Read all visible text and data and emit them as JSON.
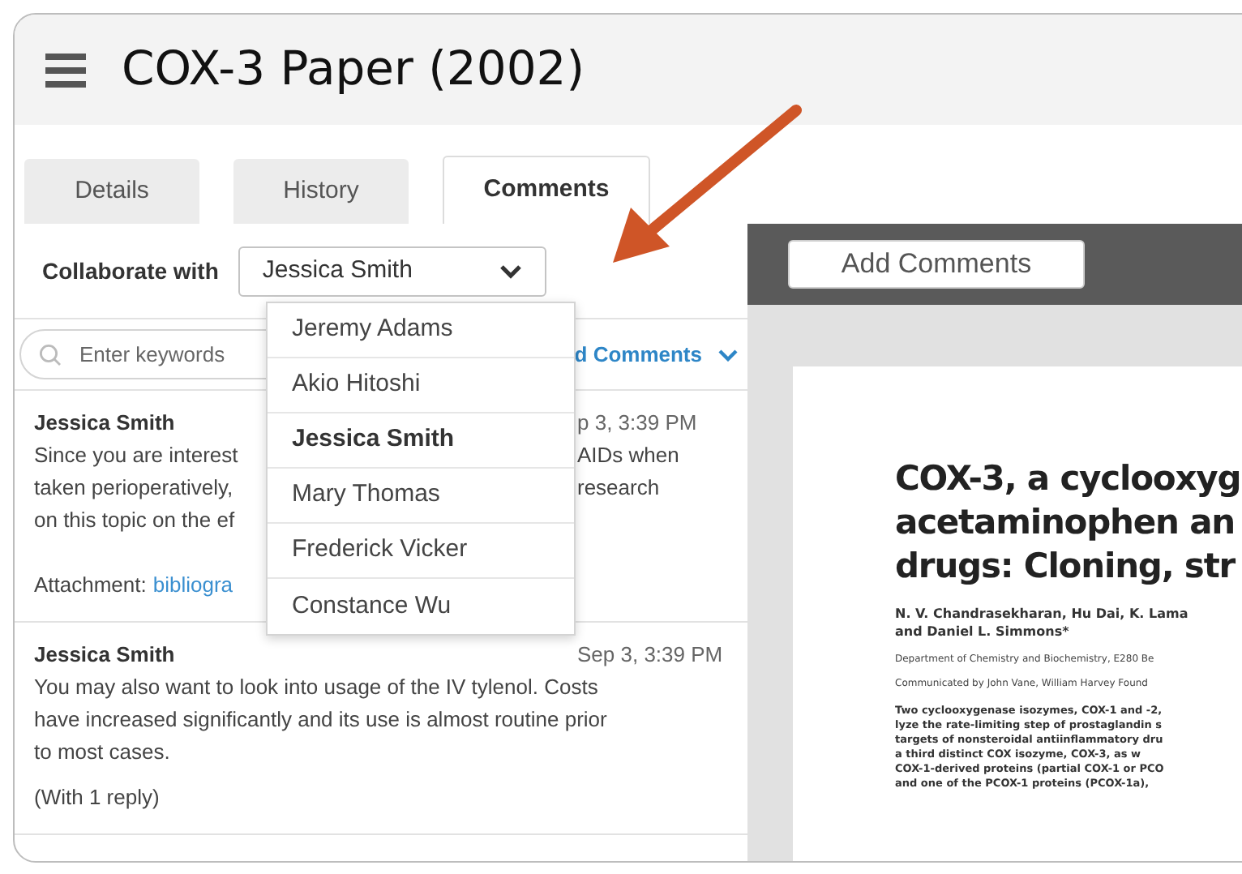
{
  "header": {
    "title": "COX-3 Paper (2002)"
  },
  "tabs": [
    {
      "label": "Details",
      "selected": false
    },
    {
      "label": "History",
      "selected": false
    },
    {
      "label": "Comments",
      "selected": true
    }
  ],
  "collaborate": {
    "label": "Collaborate with",
    "value": "Jessica Smith",
    "expanded": true,
    "options": [
      {
        "label": "Jeremy Adams",
        "selected": false
      },
      {
        "label": "Akio Hitoshi",
        "selected": false
      },
      {
        "label": "Jessica Smith",
        "selected": true
      },
      {
        "label": "Mary Thomas",
        "selected": false
      },
      {
        "label": "Frederick Vicker",
        "selected": false
      },
      {
        "label": "Constance Wu",
        "selected": false
      }
    ]
  },
  "search": {
    "placeholder": "Enter keywords"
  },
  "sort_link": "d Comments",
  "comments": [
    {
      "author": "Jessica Smith",
      "date": "p 3, 3:39 PM",
      "lines": [
        {
          "left": "Since you are interest",
          "right": "AIDs when"
        },
        {
          "left": "taken perioperatively,",
          "right": "research"
        },
        {
          "left": "on this topic on the ef"
        }
      ],
      "attachment": {
        "label": "Attachment:",
        "link": "bibliogra"
      }
    },
    {
      "author": "Jessica Smith",
      "date": "Sep 3, 3:39 PM",
      "lines": [
        {
          "left": "You may also want to look into usage of the IV tylenol.  Costs"
        },
        {
          "left": "have increased significantly and its use is almost routine prior"
        },
        {
          "left": "to most cases."
        }
      ],
      "replies": "(With 1 reply)"
    }
  ],
  "viewer": {
    "button": "Add Comments",
    "document": {
      "title_lines": [
        "COX-3, a cyclooxyg",
        "acetaminophen an",
        "drugs: Cloning, str"
      ],
      "authors": [
        "N. V. Chandrasekharan, Hu Dai, K. Lama",
        "and Daniel L. Simmons*"
      ],
      "affiliation": "Department of Chemistry and Biochemistry, E280 Be",
      "communicated": "Communicated by John Vane, William Harvey Found",
      "abstract_lines": [
        "Two cyclooxygenase isozymes, COX-1 and -2,",
        "lyze the rate-limiting step of prostaglandin s",
        "targets of nonsteroidal antiinflammatory dru",
        "a third distinct COX isozyme, COX-3, as w",
        "COX-1-derived proteins (partial COX-1 or PCO",
        "and one of the PCOX-1 proteins (PCOX-1a),"
      ]
    }
  }
}
